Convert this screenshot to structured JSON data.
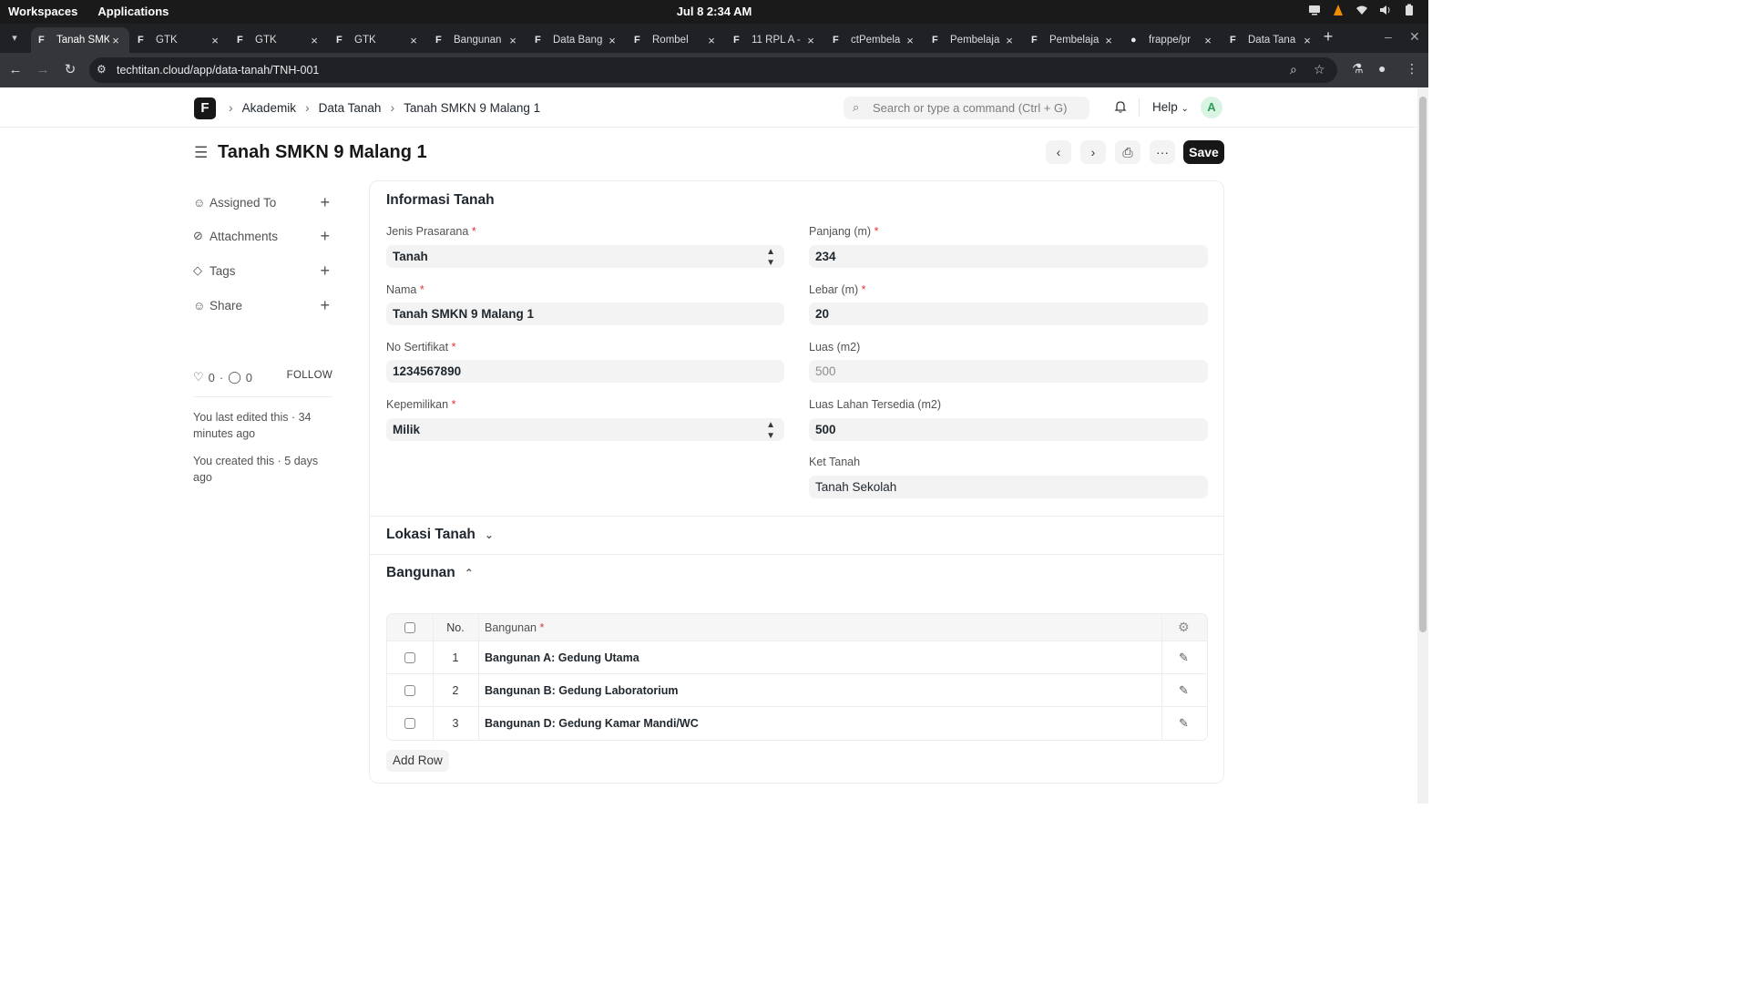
{
  "os": {
    "workspaces": "Workspaces",
    "applications": "Applications",
    "clock": "Jul 8  2:34 AM"
  },
  "browser": {
    "tabs": [
      {
        "title": "Tanah SMK",
        "active": true
      },
      {
        "title": "GTK"
      },
      {
        "title": "GTK"
      },
      {
        "title": "GTK"
      },
      {
        "title": "Bangunan"
      },
      {
        "title": "Data Bang"
      },
      {
        "title": "Rombel"
      },
      {
        "title": "11 RPL A -"
      },
      {
        "title": "ctPembela"
      },
      {
        "title": "Pembelaja"
      },
      {
        "title": "Pembelaja"
      },
      {
        "title": "frappe/pr"
      },
      {
        "title": "Data Tana"
      }
    ],
    "url": "techtitan.cloud/app/data-tanah/TNH-001"
  },
  "navbar": {
    "logo": "F",
    "breadcrumbs": [
      "Akademik",
      "Data Tanah",
      "Tanah SMKN 9 Malang 1"
    ],
    "search_placeholder": "Search or type a command (Ctrl + G)",
    "help_label": "Help",
    "avatar_initial": "A"
  },
  "page": {
    "title": "Tanah SMKN 9 Malang 1",
    "save_label": "Save"
  },
  "sidebar": {
    "items": [
      {
        "label": "Assigned To",
        "icon": "assign-icon"
      },
      {
        "label": "Attachments",
        "icon": "paperclip-icon"
      },
      {
        "label": "Tags",
        "icon": "tag-icon"
      },
      {
        "label": "Share",
        "icon": "share-icon"
      }
    ],
    "likes": "0",
    "comments": "0",
    "follow_label": "FOLLOW",
    "last_edited": "You last edited this · 34 minutes ago",
    "created": "You created this · 5 days ago"
  },
  "form": {
    "section_info": "Informasi Tanah",
    "fields": {
      "jenis_prasarana": {
        "label": "Jenis Prasarana",
        "value": "Tanah"
      },
      "nama": {
        "label": "Nama",
        "value": "Tanah SMKN 9 Malang 1"
      },
      "no_sertifikat": {
        "label": "No Sertifikat",
        "value": "1234567890"
      },
      "kepemilikan": {
        "label": "Kepemilikan",
        "value": "Milik"
      },
      "panjang": {
        "label": "Panjang (m)",
        "value": "234"
      },
      "lebar": {
        "label": "Lebar (m)",
        "value": "20"
      },
      "luas": {
        "label": "Luas (m2)",
        "value": "500"
      },
      "luas_tersedia": {
        "label": "Luas Lahan Tersedia (m2)",
        "value": "500"
      },
      "ket_tanah": {
        "label": "Ket Tanah",
        "value": "Tanah Sekolah"
      }
    },
    "section_lokasi": "Lokasi Tanah",
    "section_bangunan": "Bangunan",
    "table": {
      "col_no": "No.",
      "col_bangunan": "Bangunan",
      "rows": [
        {
          "no": "1",
          "bangunan": "Bangunan A: Gedung Utama"
        },
        {
          "no": "2",
          "bangunan": "Bangunan B: Gedung Laboratorium"
        },
        {
          "no": "3",
          "bangunan": "Bangunan D: Gedung Kamar Mandi/WC"
        }
      ]
    },
    "add_row_label": "Add Row"
  },
  "required_mark": "*"
}
